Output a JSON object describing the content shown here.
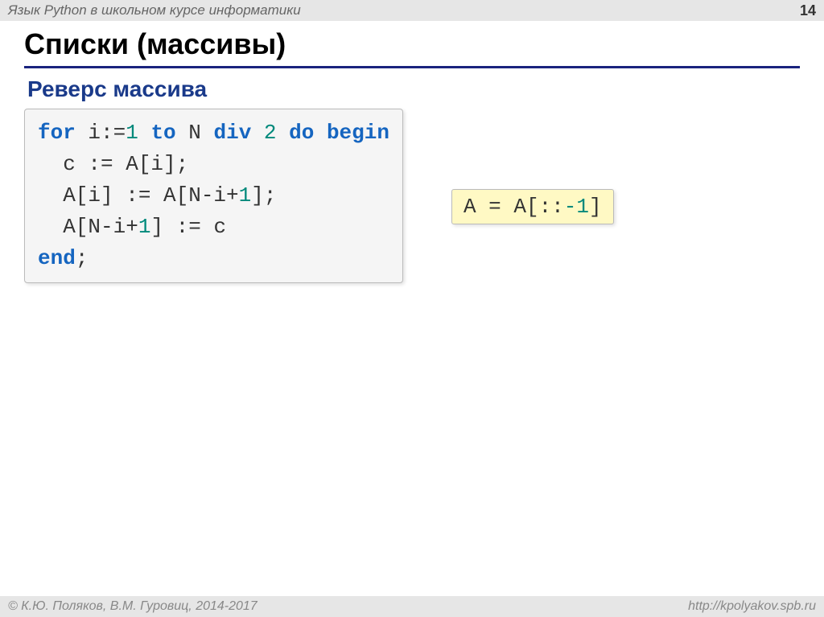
{
  "header": {
    "course_title": "Язык Python в школьном курсе информатики",
    "page_number": "14"
  },
  "main": {
    "title": "Списки (массивы)",
    "subtitle": "Реверс массива"
  },
  "pascal": {
    "l1_kw1": "for",
    "l1_p1": " i:=",
    "l1_n1": "1",
    "l1_p2": " ",
    "l1_kw2": "to",
    "l1_p3": " N ",
    "l1_kw3": "div",
    "l1_p4": " ",
    "l1_n2": "2",
    "l1_p5": " ",
    "l1_kw4": "do",
    "l1_p6": " ",
    "l1_kw5": "begin",
    "l2": "  c := A[i];",
    "l3_p1": "  A[i] := A[N-i+",
    "l3_n1": "1",
    "l3_p2": "];",
    "l4_p1": "  A[N-i+",
    "l4_n1": "1",
    "l4_p2": "] := c",
    "l5_kw1": "end",
    "l5_p1": ";"
  },
  "python": {
    "p1": "A = A[::",
    "n1": "-1",
    "p2": "]"
  },
  "footer": {
    "copyright": "© К.Ю. Поляков, В.М. Гуровиц, 2014-2017",
    "url": "http://kpolyakov.spb.ru"
  }
}
